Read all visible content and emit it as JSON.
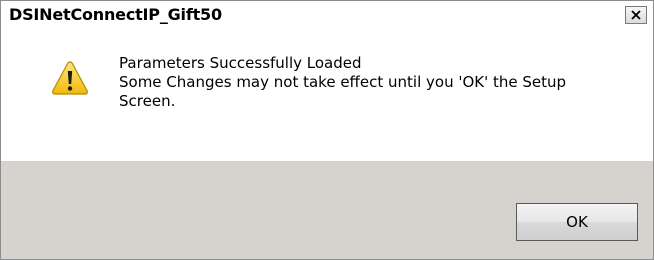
{
  "window": {
    "title": "DSINetConnectIP_Gift50",
    "close_icon": "close-icon"
  },
  "dialog": {
    "icon": "warning-icon",
    "message_lines": [
      "Parameters Successfully Loaded",
      "Some Changes may not take effect until you 'OK' the Setup",
      "Screen."
    ]
  },
  "buttons": {
    "ok_label": "OK"
  },
  "colors": {
    "footer_background": "#d6d3ce",
    "content_background": "#ffffff",
    "warning_yellow": "#f5c518"
  }
}
